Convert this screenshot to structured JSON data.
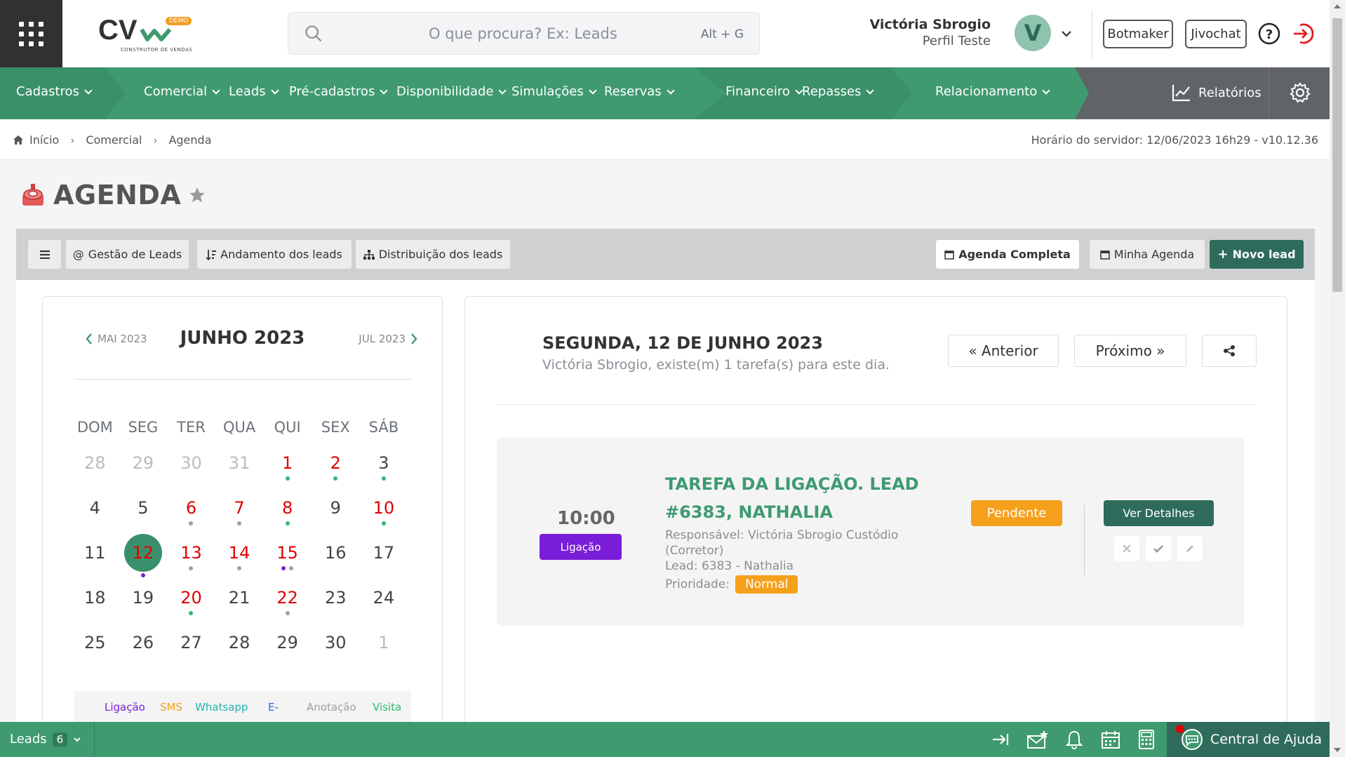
{
  "header": {
    "logo_text": "CV",
    "logo_badge": "DEMO",
    "logo_subtitle": "CONSTRUTOR DE VENDAS",
    "search_placeholder": "O que procura? Ex: Leads",
    "search_shortcut": "Alt + G",
    "user_name": "Victória Sbrogio",
    "user_profile": "Perfil Teste",
    "avatar_letter": "V",
    "botmaker_label": "Botmaker",
    "jivochat_label": "Jivochat"
  },
  "nav": {
    "items": [
      "Cadastros",
      "Comercial",
      "Leads",
      "Pré-cadastros",
      "Disponibilidade",
      "Simulações",
      "Reservas",
      "Financeiro",
      "Repasses",
      "Relacionamento"
    ],
    "reports_label": "Relatórios",
    "colors": {
      "primary": "#3f9a70",
      "dark": "#2f6b5b",
      "gray": "#606468"
    }
  },
  "breadcrumb": {
    "items": [
      "Início",
      "Comercial",
      "Agenda"
    ],
    "server_time": "Horário do servidor: 12/06/2023 16h29 - v10.12.36"
  },
  "page": {
    "title": "AGENDA"
  },
  "toolbar": {
    "menu_icon": "bars-icon",
    "gestao_label": "Gestão de Leads",
    "andamento_label": "Andamento dos leads",
    "distribuicao_label": "Distribuição dos leads",
    "agenda_completa_label": "Agenda Completa",
    "minha_agenda_label": "Minha Agenda",
    "novo_lead_label": "Novo lead"
  },
  "calendar": {
    "prev_month": "MAI 2023",
    "month": "JUNHO 2023",
    "next_month": "JUL 2023",
    "weekdays": [
      "DOM",
      "SEG",
      "TER",
      "QUA",
      "QUI",
      "SEX",
      "SÁB"
    ],
    "weeks": [
      [
        "28",
        "29",
        "30",
        "31",
        "1",
        "2",
        "3"
      ],
      [
        "4",
        "5",
        "6",
        "7",
        "8",
        "9",
        "10"
      ],
      [
        "11",
        "12",
        "13",
        "14",
        "15",
        "16",
        "17"
      ],
      [
        "18",
        "19",
        "20",
        "21",
        "22",
        "23",
        "24"
      ],
      [
        "25",
        "26",
        "27",
        "28",
        "29",
        "30",
        "1"
      ]
    ],
    "legend": [
      "Ligação",
      "SMS",
      "Whatsapp",
      "E-",
      "Anotação",
      "Visita"
    ],
    "legend_colors": [
      "#7a1dd8",
      "#f5a01b",
      "#1fb5b0",
      "#1a73e8",
      "#a0a0a0",
      "#2dbb6b"
    ]
  },
  "day": {
    "title": "SEGUNDA, 12 DE JUNHO 2023",
    "subtitle": "Victória Sbrogio, existe(m) 1 tarefa(s) para este dia.",
    "prev_label": "« Anterior",
    "next_label": "Próximo »"
  },
  "task": {
    "time": "10:00",
    "type": "Ligação",
    "title": "TAREFA DA LIGAÇÃO. LEAD #6383, NATHALIA",
    "responsible": "Responsável: Victória Sbrogio Custódio (Corretor)",
    "lead": "Lead: 6383 - Nathalia",
    "priority_label": "Prioridade:",
    "priority": "Normal",
    "status": "Pendente",
    "details_label": "Ver Detalhes"
  },
  "bottom": {
    "leads_label": "Leads",
    "leads_count": "6",
    "help_center_label": "Central de Ajuda"
  }
}
